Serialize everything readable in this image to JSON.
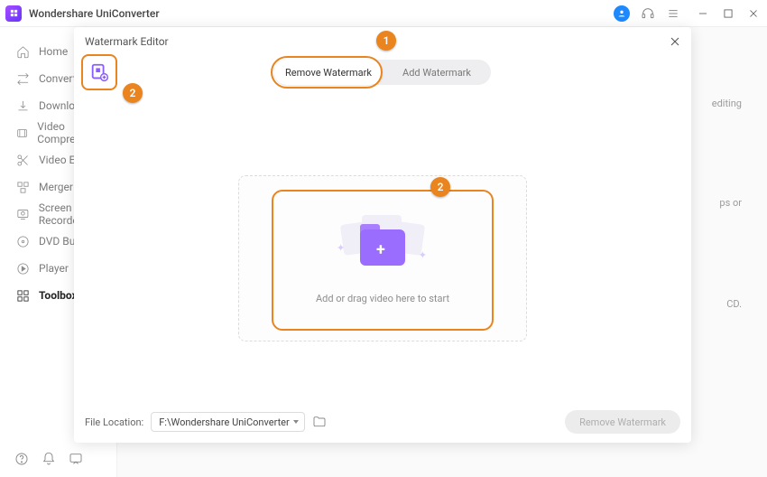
{
  "titlebar": {
    "app_name": "Wondershare UniConverter"
  },
  "sidebar": {
    "items": [
      {
        "label": "Home"
      },
      {
        "label": "Converter"
      },
      {
        "label": "Downloader"
      },
      {
        "label": "Video Compressor"
      },
      {
        "label": "Video Editor"
      },
      {
        "label": "Merger"
      },
      {
        "label": "Screen Recorder"
      },
      {
        "label": "DVD Burner"
      },
      {
        "label": "Player"
      },
      {
        "label": "Toolbox"
      }
    ]
  },
  "modal": {
    "title": "Watermark Editor",
    "tabs": {
      "remove": "Remove Watermark",
      "add": "Add Watermark"
    },
    "drop_text": "Add or drag video here to start",
    "file_location_label": "File Location:",
    "file_location_value": "F:\\Wondershare UniConverter",
    "action_button": "Remove Watermark"
  },
  "callouts": {
    "one": "1",
    "two_a": "2",
    "two_b": "2"
  },
  "bg_snips": {
    "a": "editing",
    "b": "ps or",
    "c": "CD."
  }
}
